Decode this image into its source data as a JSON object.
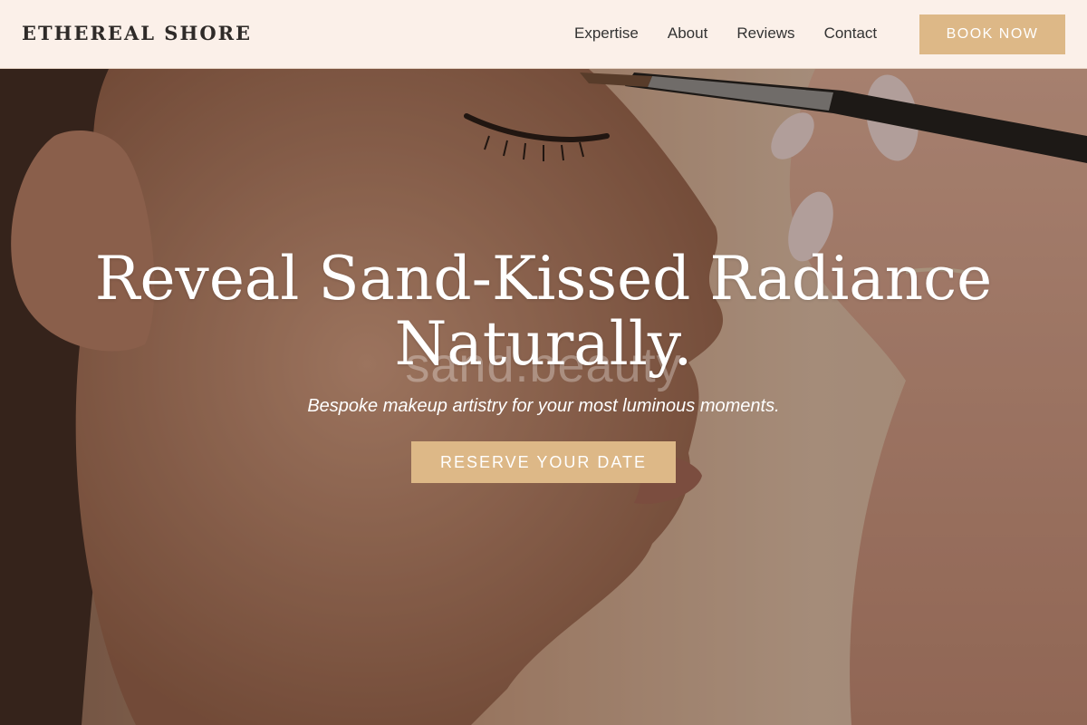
{
  "header": {
    "brand": "ETHEREAL SHORE",
    "nav": [
      {
        "label": "Expertise"
      },
      {
        "label": "About"
      },
      {
        "label": "Reviews"
      },
      {
        "label": "Contact"
      }
    ],
    "book_button": "BOOK NOW"
  },
  "hero": {
    "title_line1": "Reveal Sand-Kissed Radiance",
    "title_line2": "Naturally.",
    "watermark": "sand.beauty",
    "subtitle": "Bespoke makeup artistry for your most luminous moments.",
    "cta_button": "RESERVE YOUR DATE",
    "image_alt": "makeup-application-photo"
  },
  "colors": {
    "accent": "#ddb887",
    "header_bg": "#fbf0e9",
    "brand_text": "#2e2a28",
    "hero_text": "#ffffff"
  }
}
